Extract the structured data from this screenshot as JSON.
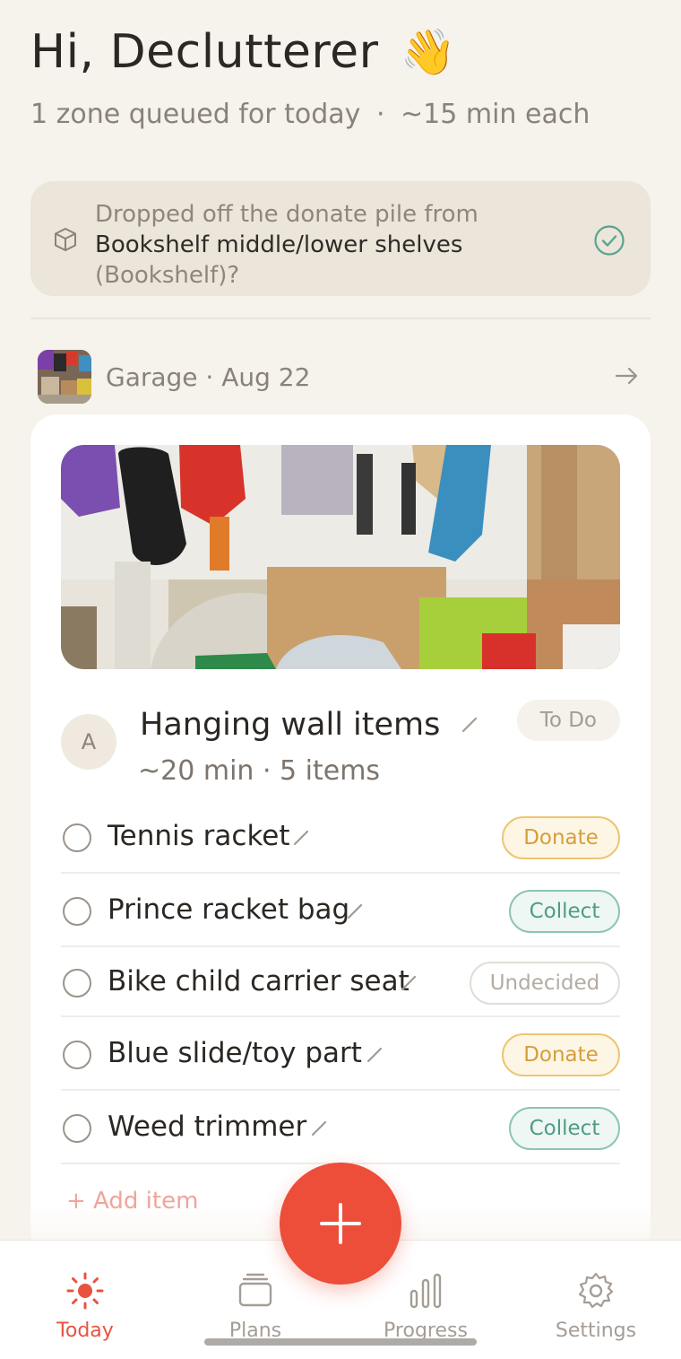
{
  "header": {
    "greeting": "Hi, Declutterer",
    "wave_emoji": "👋",
    "subtitle_zones": "1 zone queued for today",
    "subtitle_sep": "·",
    "subtitle_time": "~15 min each"
  },
  "banner": {
    "line1": "Dropped off the donate pile from",
    "line2": "Bookshelf middle/lower shelves",
    "line3": "(Bookshelf)?",
    "icon": "box-icon",
    "confirm_icon": "check-circle-icon"
  },
  "zone": {
    "label": "Garage · Aug 22",
    "thumb_icon": "zone-thumbnail",
    "arrow_icon": "arrow-right-icon"
  },
  "task": {
    "avatar_letter": "A",
    "title": "Hanging wall items",
    "status": "To Do",
    "meta": "~20 min · 5 items",
    "items": [
      {
        "name": "Tennis racket",
        "tag": "Donate",
        "tag_type": "donate"
      },
      {
        "name": "Prince racket bag",
        "tag": "Collect",
        "tag_type": "collect"
      },
      {
        "name": "Bike child carrier seat",
        "tag": "Undecided",
        "tag_type": "undecided"
      },
      {
        "name": "Blue slide/toy part",
        "tag": "Donate",
        "tag_type": "donate"
      },
      {
        "name": "Weed trimmer",
        "tag": "Collect",
        "tag_type": "collect"
      }
    ],
    "add_item": "+ Add item"
  },
  "tabs": [
    {
      "label": "Today",
      "icon": "sun-icon",
      "active": true
    },
    {
      "label": "Plans",
      "icon": "stack-icon",
      "active": false
    },
    {
      "label": "Progress",
      "icon": "bar-chart-icon",
      "active": false
    },
    {
      "label": "Settings",
      "icon": "gear-icon",
      "active": false
    }
  ],
  "colors": {
    "accent": "#ec4e3a",
    "background": "#f6f2ec",
    "donate": "#d59e3a",
    "collect": "#4f9b88"
  }
}
